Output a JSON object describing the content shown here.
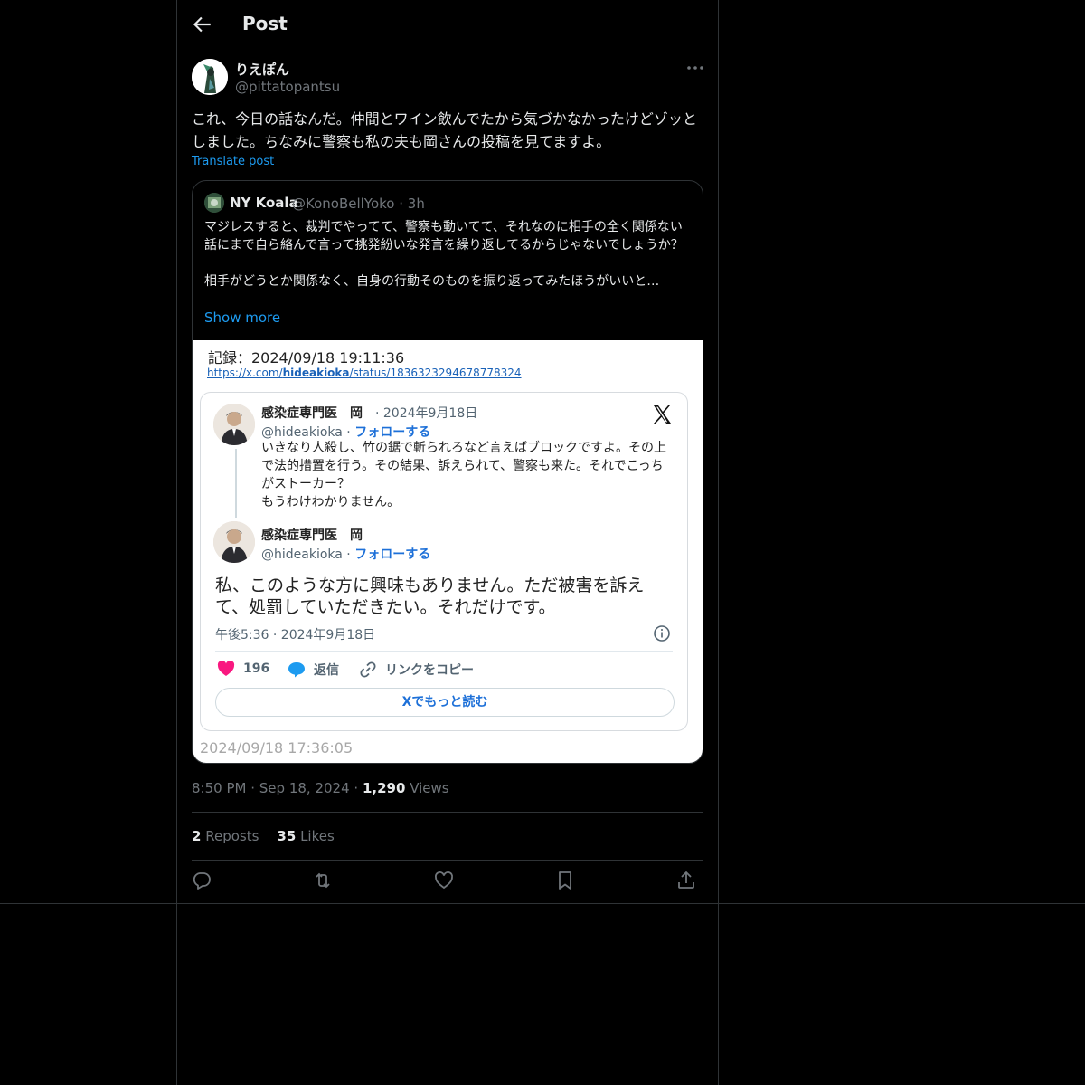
{
  "header": {
    "title": "Post"
  },
  "post": {
    "display_name": "りえぽん",
    "handle": "@pittatopantsu",
    "text": "これ、今日の話なんだ。仲間とワイン飲んでたから気づかなかったけどゾッとしました。ちなみに警察も私の夫も岡さんの投稿を見てますよ。",
    "translate_label": "Translate post"
  },
  "quote": {
    "display_name": "NY Koala",
    "handle": "@KonoBellYoko",
    "age": "· 3h",
    "text": "マジレスすると、裁判でやってて、警察も動いてて、それなのに相手の全く関係ない話にまで自ら絡んで言って挑発紛いな発言を繰り返してるからじゃないでしょうか？\n\n相手がどうとか関係なく、自身の行動そのものを振り返ってみたほうがいいと…",
    "show_more": "Show more",
    "screenshot": {
      "record_label": "記録：2024/09/18 19:11:36",
      "url_prefix": "https://x.com/",
      "url_user": "hideakioka",
      "url_suffix": "/status/1836323294678778324",
      "author_name": "感染症専門医　岡",
      "date": "· 2024年9月18日",
      "author_handle": "@hideakioka ·",
      "follow_label": "フォローする",
      "tweet1_text": "いきなり人殺し、竹の鋸で斬られろなど言えばブロックですよ。その上で法的措置を行う。その結果、訴えられて、警察も来た。それでこっちがストーカー？\nもうわけわかりません。",
      "tweet2_text": "私、このような方に興味もありません。ただ被害を訴えて、処罰していただきたい。それだけです。",
      "timestamp": "午後5:36 · 2024年9月18日",
      "likes": "196",
      "reply_label": "返信",
      "copy_link_label": "リンクをコピー",
      "read_more_label": "Xでもっと読む",
      "capture_time": "2024/09/18 17:36:05"
    }
  },
  "meta": {
    "time": "8:50 PM",
    "date": "Sep 18, 2024",
    "views_count": "1,290",
    "views_label": "Views"
  },
  "stats": {
    "reposts_count": "2",
    "reposts_label": "Reposts",
    "likes_count": "35",
    "likes_label": "Likes"
  },
  "icons": [
    "back-arrow-icon",
    "more-icon",
    "x-logo-icon",
    "info-icon",
    "heart-icon",
    "reply-bubble-icon",
    "link-icon",
    "reply-icon",
    "repost-icon",
    "like-icon",
    "bookmark-icon",
    "share-icon"
  ],
  "colors": {
    "accent": "#1d9bf0",
    "background": "#000000",
    "muted": "#71767b",
    "like": "#f91880"
  }
}
